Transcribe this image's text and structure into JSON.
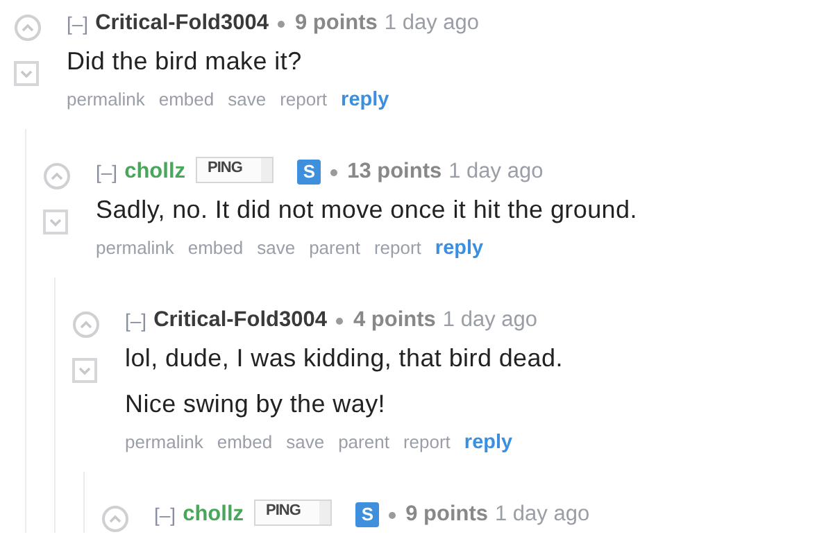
{
  "comments": [
    {
      "collapse": "[–]",
      "author": "Critical-Fold3004",
      "is_op": false,
      "points": "9 points",
      "time": "1 day ago",
      "paragraphs": [
        "Did the bird make it?"
      ],
      "buttons": [
        {
          "label": "permalink",
          "kind": "link"
        },
        {
          "label": "embed",
          "kind": "link"
        },
        {
          "label": "save",
          "kind": "link"
        },
        {
          "label": "report",
          "kind": "link"
        },
        {
          "label": "reply",
          "kind": "reply"
        }
      ],
      "children": [
        {
          "collapse": "[–]",
          "author": "chollz",
          "is_op": true,
          "flair": "PING",
          "op_badge": "S",
          "points": "13 points",
          "time": "1 day ago",
          "paragraphs": [
            "Sadly, no. It did not move once it hit the ground."
          ],
          "buttons": [
            {
              "label": "permalink",
              "kind": "link"
            },
            {
              "label": "embed",
              "kind": "link"
            },
            {
              "label": "save",
              "kind": "link"
            },
            {
              "label": "parent",
              "kind": "link"
            },
            {
              "label": "report",
              "kind": "link"
            },
            {
              "label": "reply",
              "kind": "reply"
            }
          ],
          "children": [
            {
              "collapse": "[–]",
              "author": "Critical-Fold3004",
              "is_op": false,
              "points": "4 points",
              "time": "1 day ago",
              "paragraphs": [
                "lol, dude, I was kidding, that bird dead.",
                "Nice swing by the way!"
              ],
              "buttons": [
                {
                  "label": "permalink",
                  "kind": "link"
                },
                {
                  "label": "embed",
                  "kind": "link"
                },
                {
                  "label": "save",
                  "kind": "link"
                },
                {
                  "label": "parent",
                  "kind": "link"
                },
                {
                  "label": "report",
                  "kind": "link"
                },
                {
                  "label": "reply",
                  "kind": "reply"
                }
              ],
              "children": [
                {
                  "collapse": "[–]",
                  "author": "chollz",
                  "is_op": true,
                  "flair": "PING",
                  "op_badge": "S",
                  "points": "9 points",
                  "time": "1 day ago"
                }
              ]
            }
          ]
        }
      ]
    }
  ]
}
